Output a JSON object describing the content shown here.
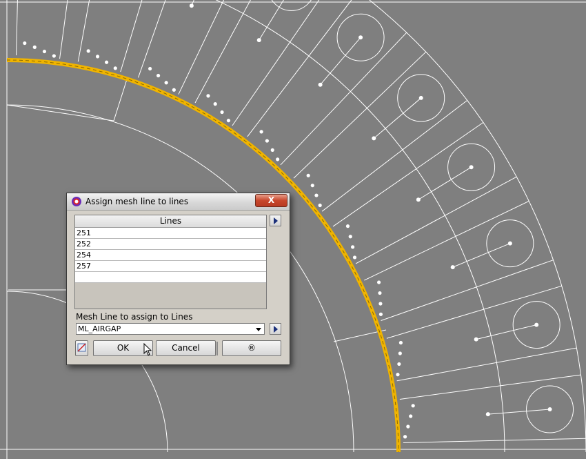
{
  "dialog": {
    "title": "Assign mesh line to lines",
    "close_label": "X",
    "table": {
      "header": "Lines",
      "rows": [
        "251",
        "252",
        "254",
        "257"
      ]
    },
    "mesh_label": "Mesh Line to assign to Lines",
    "mesh_value": "ML_AIRGAP",
    "ok_label": "OK",
    "cancel_label": "Cancel",
    "help_label": "®"
  },
  "colors": {
    "background": "#7f7f7f",
    "geometry_line": "#ffffff",
    "selected_line": "#f0b400"
  }
}
